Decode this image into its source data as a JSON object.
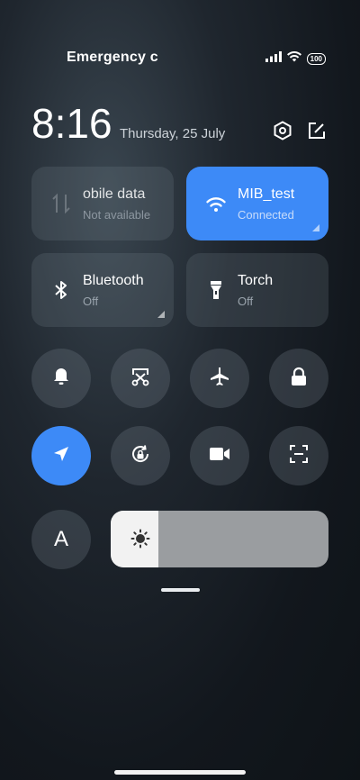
{
  "status_bar": {
    "left_text": "Emergency c",
    "battery_level": "100"
  },
  "header": {
    "time": "8:16",
    "date": "Thursday, 25 July"
  },
  "tiles": [
    {
      "name": "obile data",
      "sub": "Not available",
      "active": false,
      "icon": "mobile-data-icon"
    },
    {
      "name": "MIB_test",
      "sub": "Connected",
      "active": true,
      "icon": "wifi-icon"
    },
    {
      "name": "Bluetooth",
      "sub": "Off",
      "active": false,
      "icon": "bluetooth-icon"
    },
    {
      "name": "Torch",
      "sub": "Off",
      "active": false,
      "icon": "torch-icon"
    }
  ],
  "toggles": [
    {
      "icon": "bell-icon",
      "active": false
    },
    {
      "icon": "screenshot-icon",
      "active": false
    },
    {
      "icon": "airplane-icon",
      "active": false
    },
    {
      "icon": "lock-icon",
      "active": false
    },
    {
      "icon": "location-icon",
      "active": true
    },
    {
      "icon": "rotation-lock-icon",
      "active": false
    },
    {
      "icon": "video-icon",
      "active": false
    },
    {
      "icon": "scan-icon",
      "active": false
    },
    {
      "icon": "font-size-icon",
      "label": "A",
      "active": false
    }
  ],
  "brightness": {
    "level_fraction": 0.22
  },
  "colors": {
    "accent": "#3d8af7",
    "tile_bg": "#2c343c"
  }
}
